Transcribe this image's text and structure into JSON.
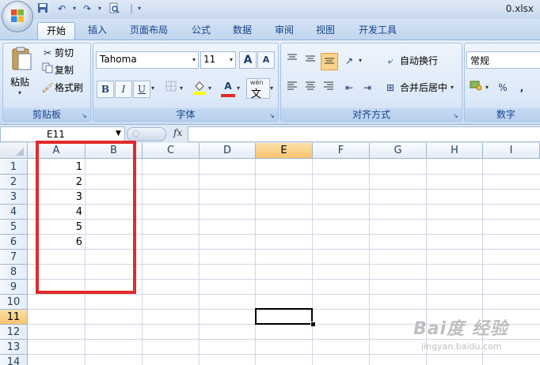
{
  "window": {
    "title": "0.xlsx"
  },
  "quick_access": {
    "save_icon": "save-icon",
    "undo_icon": "undo-icon",
    "redo_icon": "redo-icon",
    "preview_icon": "print-preview-icon"
  },
  "tabs": [
    "开始",
    "插入",
    "页面布局",
    "公式",
    "数据",
    "审阅",
    "视图",
    "开发工具"
  ],
  "active_tab": "开始",
  "clipboard": {
    "paste": "粘贴",
    "cut": "剪切",
    "copy": "复制",
    "format_painter": "格式刷",
    "group_label": "剪贴板"
  },
  "font": {
    "name": "Tahoma",
    "size": "11",
    "bold": "B",
    "italic": "I",
    "underline": "U",
    "grow": "A",
    "shrink": "A",
    "phonetic_top": "wén",
    "phonetic_char": "文",
    "color_letter": "A",
    "group_label": "字体"
  },
  "alignment": {
    "wrap_text": "自动换行",
    "merge_center": "合并后居中",
    "group_label": "对齐方式"
  },
  "number": {
    "format": "常规",
    "percent": "%",
    "comma": ",",
    "group_label": "数字"
  },
  "formula_bar": {
    "name_box": "E11",
    "fx": "fx",
    "formula": ""
  },
  "columns": [
    "A",
    "B",
    "C",
    "D",
    "E",
    "F",
    "G",
    "H",
    "I"
  ],
  "selected_column": "E",
  "rows": [
    "1",
    "2",
    "3",
    "4",
    "5",
    "6",
    "7",
    "8",
    "9",
    "10",
    "11",
    "12",
    "13",
    "14"
  ],
  "selected_row": "11",
  "cells": {
    "A1": "1",
    "A2": "2",
    "A3": "3",
    "A4": "4",
    "A5": "5",
    "A6": "6"
  },
  "watermark": {
    "line1": "Bai度 经验",
    "line2": "jingyan.baidu.com"
  },
  "colors": {
    "highlight": "#e22a2a",
    "selection_header": "#f8c46f",
    "tab_text": "#15428b"
  }
}
